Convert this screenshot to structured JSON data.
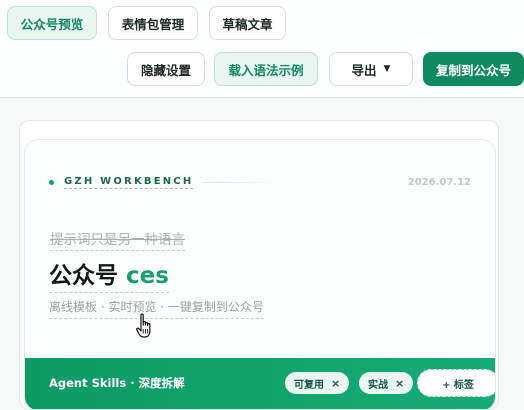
{
  "tabs": [
    {
      "label": "公众号预览",
      "active": true
    },
    {
      "label": "表情包管理"
    },
    {
      "label": "草稿文章"
    }
  ],
  "toolbar": {
    "hide_settings": "隐藏设置",
    "load_examples": "载入语法示例",
    "export_label": "导出",
    "copy_to_gzh": "复制到公众号"
  },
  "preview": {
    "kicker": "GZH WORKBENCH",
    "date": "2026.07.12",
    "prompt_text": "提示词只是另一种语言",
    "title_main": "公众号",
    "title_accent": "ces",
    "subtitle": "离线模板 · 实时预览 · 一键复制到公众号",
    "band_title": "Agent Skills · 深度拆解",
    "tags": [
      {
        "label": "可复用"
      },
      {
        "label": "实战"
      }
    ],
    "add_tag_label": "+ 标签"
  },
  "colors": {
    "accent": "#0f8a5e",
    "accent_light": "#e8f6ef",
    "band": "#10a26b"
  },
  "icons": {
    "export_caret": "caret-down-icon",
    "tag_remove": "close-icon",
    "pointer": "hand-pointer-icon"
  }
}
